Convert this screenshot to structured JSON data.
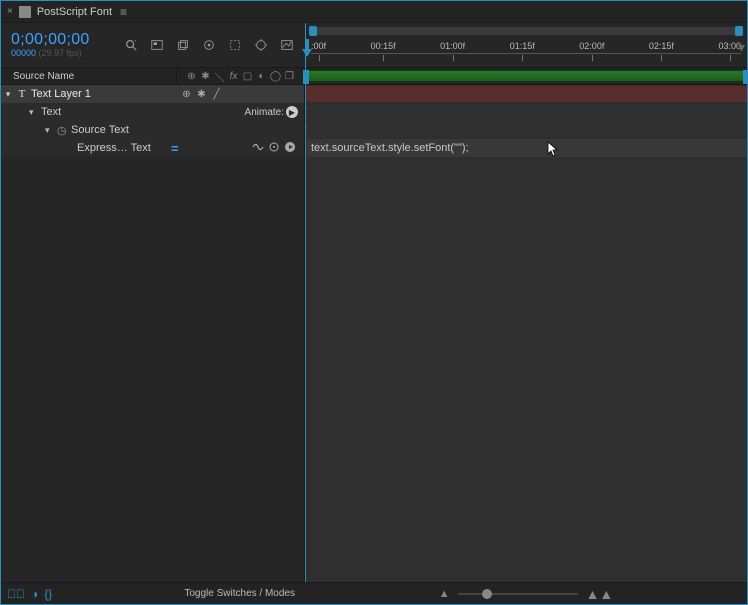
{
  "tab": {
    "title": "PostScript Font"
  },
  "timecode": {
    "main": "0;00;00;00",
    "frame": "00000",
    "fps": "(29.97 fps)"
  },
  "ruler": {
    "ticks": [
      ":00f",
      "00:15f",
      "01:00f",
      "01:15f",
      "02:00f",
      "02:15f",
      "03:00"
    ]
  },
  "columns": {
    "sourceName": "Source Name"
  },
  "layer": {
    "name": "Text Layer 1",
    "props": {
      "text": "Text",
      "animateLabel": "Animate:",
      "sourceText": "Source Text",
      "expressionLabel": "Express… Text"
    }
  },
  "expression": {
    "code": "text.sourceText.style.setFont(\"\");"
  },
  "footer": {
    "toggleLabel": "Toggle Switches / Modes"
  }
}
